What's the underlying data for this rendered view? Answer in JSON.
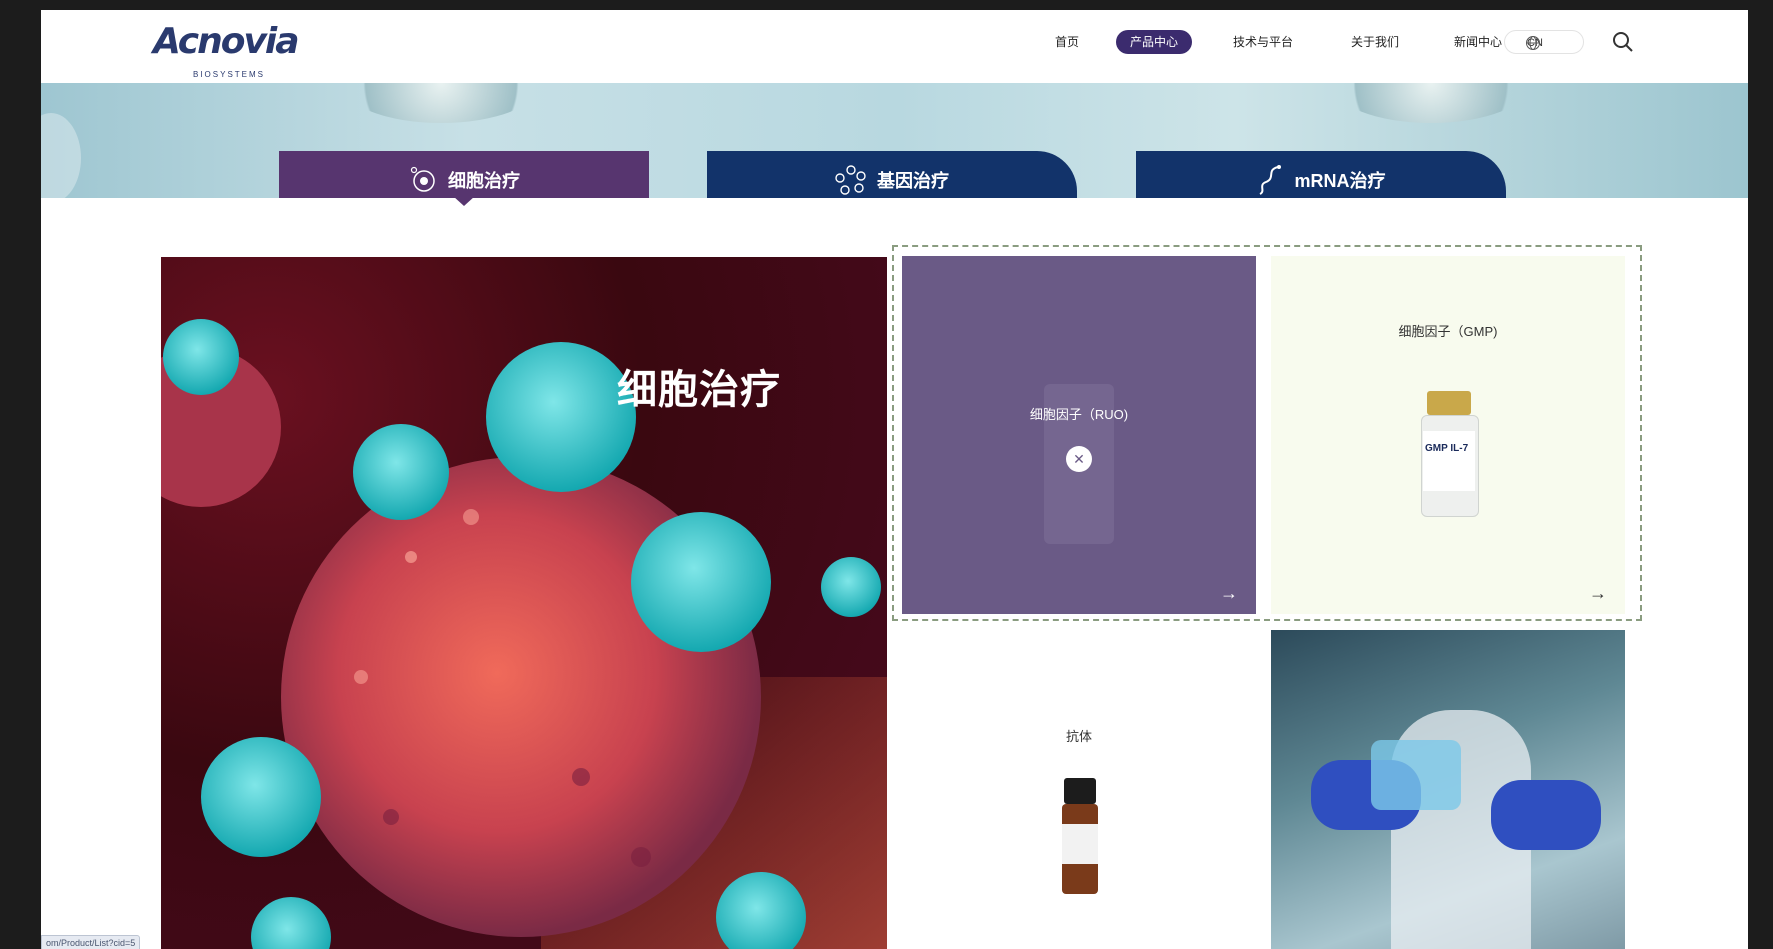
{
  "header": {
    "logo_text": "Acnovia",
    "logo_sub": "BIOSYSTEMS",
    "nav": [
      {
        "label": "首页"
      },
      {
        "label": "产品中心"
      },
      {
        "label": "技术与平台"
      },
      {
        "label": "关于我们"
      },
      {
        "label": "新闻中心"
      }
    ],
    "active_nav": "产品中心",
    "lang_label": "CN"
  },
  "tabs": [
    {
      "label": "细胞治疗",
      "icon": "cell-icon"
    },
    {
      "label": "基因治疗",
      "icon": "gene-icon"
    },
    {
      "label": "mRNA治疗",
      "icon": "mrna-icon"
    }
  ],
  "hero": {
    "title": "细胞治疗"
  },
  "products": [
    {
      "title": "细胞因子（RUO)"
    },
    {
      "title": "细胞因子（GMP)",
      "vial_label": "GMP IL-7"
    },
    {
      "title": "抗体"
    }
  ],
  "status_url": "om/Product/List?cid=5",
  "colors": {
    "brand_navy": "#12336a",
    "brand_purple": "#57356f",
    "active_nav": "#3b2b6e",
    "ruo_card": "#6a5a86",
    "gmp_card": "#f8fbee"
  }
}
